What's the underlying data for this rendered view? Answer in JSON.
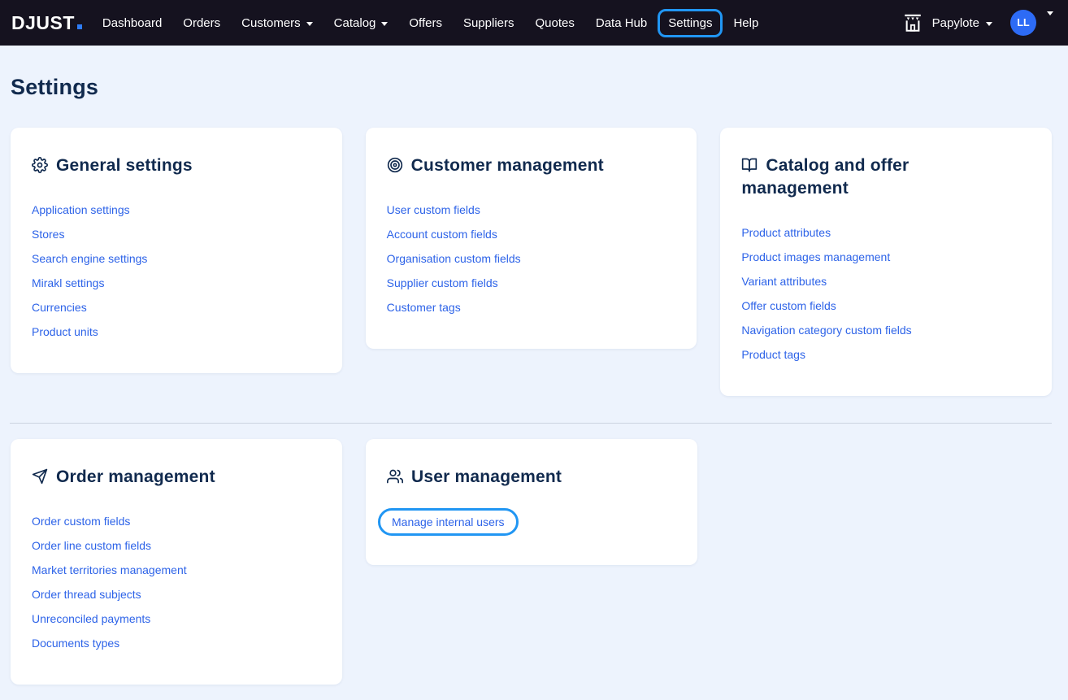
{
  "navbar": {
    "logo_text": "DJUST",
    "items": [
      {
        "label": "Dashboard",
        "dropdown": false
      },
      {
        "label": "Orders",
        "dropdown": false
      },
      {
        "label": "Customers",
        "dropdown": true
      },
      {
        "label": "Catalog",
        "dropdown": true
      },
      {
        "label": "Offers",
        "dropdown": false
      },
      {
        "label": "Suppliers",
        "dropdown": false
      },
      {
        "label": "Quotes",
        "dropdown": false
      },
      {
        "label": "Data Hub",
        "dropdown": false
      },
      {
        "label": "Settings",
        "dropdown": false,
        "focused": true
      },
      {
        "label": "Help",
        "dropdown": false
      }
    ],
    "store_name": "Papylote",
    "avatar_initials": "LL"
  },
  "page": {
    "title": "Settings"
  },
  "cards": [
    {
      "title": "General settings",
      "icon": "gear-icon",
      "links": [
        "Application settings",
        "Stores",
        "Search engine settings",
        "Mirakl settings",
        "Currencies",
        "Product units"
      ]
    },
    {
      "title": "Customer management",
      "icon": "target-icon",
      "links": [
        "User custom fields",
        "Account custom fields",
        "Organisation custom fields",
        "Supplier custom fields",
        "Customer tags"
      ]
    },
    {
      "title": "Catalog and offer management",
      "icon": "book-open-icon",
      "links": [
        "Product attributes",
        "Product images management",
        "Variant attributes",
        "Offer custom fields",
        "Navigation category custom fields",
        "Product tags"
      ]
    },
    {
      "title": "Order management",
      "icon": "send-icon",
      "links": [
        "Order custom fields",
        "Order line custom fields",
        "Market territories management",
        "Order thread subjects",
        "Unreconciled payments",
        "Documents types"
      ]
    },
    {
      "title": "User management",
      "icon": "users-icon",
      "links": [
        "Manage internal users"
      ],
      "focused_link": "Manage internal users"
    }
  ],
  "colors": {
    "navbar_bg": "#15121f",
    "page_bg": "#edf3fd",
    "heading_navy": "#112a4e",
    "link_blue": "#2d63e8",
    "focus_ring_blue": "#2196f3",
    "avatar_blue": "#2d6bf5",
    "logo_dot_blue": "#2e7cf6",
    "divider_gray": "#ccd3e0"
  }
}
